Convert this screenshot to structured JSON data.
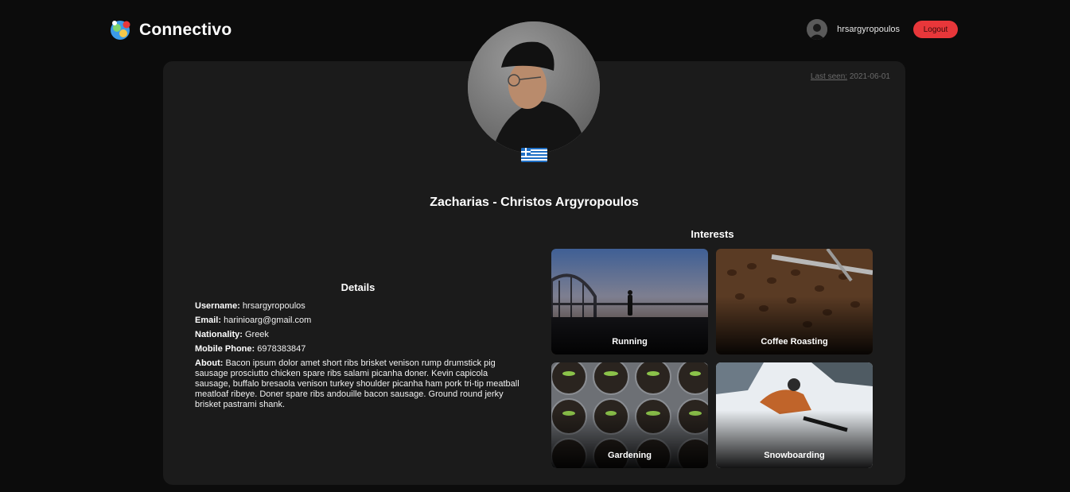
{
  "header": {
    "app_title": "Connectivo",
    "logo_icon": "connectivo-logo-icon",
    "username": "hrsargyropoulos",
    "logout_label": "Logout"
  },
  "profile": {
    "last_seen_label": "Last seen:",
    "last_seen_value": "2021-06-01",
    "full_name": "Zacharias - Christos Argyropoulos",
    "flag_icon": "greece-flag-icon"
  },
  "details": {
    "heading": "Details",
    "username_label": "Username:",
    "username_value": "hrsargyropoulos",
    "email_label": "Email:",
    "email_value": "harinioarg@gmail.com",
    "nationality_label": "Nationality:",
    "nationality_value": "Greek",
    "phone_label": "Mobile Phone:",
    "phone_value": "6978383847",
    "about_label": "About:",
    "about_value": "Bacon ipsum dolor amet short ribs brisket venison rump drumstick pig sausage prosciutto chicken spare ribs salami picanha doner. Kevin capicola sausage, buffalo bresaola venison turkey shoulder picanha ham pork tri-tip meatball meatloaf ribeye. Doner spare ribs andouille bacon sausage. Ground round jerky brisket pastrami shank."
  },
  "interests": {
    "heading": "Interests",
    "items": [
      {
        "label": "Running"
      },
      {
        "label": "Coffee Roasting"
      },
      {
        "label": "Gardening"
      },
      {
        "label": "Snowboarding"
      }
    ]
  },
  "colors": {
    "background": "#0c0c0c",
    "card": "#1b1b1b",
    "logout": "#e8373a"
  }
}
